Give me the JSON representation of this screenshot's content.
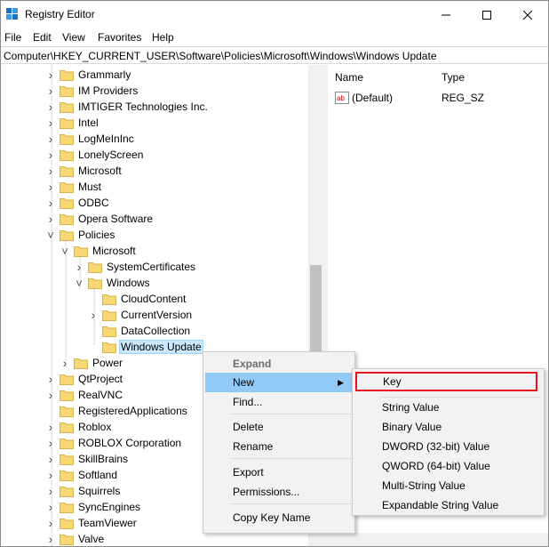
{
  "window": {
    "title": "Registry Editor"
  },
  "menubar": {
    "items": [
      "File",
      "Edit",
      "View",
      "Favorites",
      "Help"
    ]
  },
  "address": {
    "path": "Computer\\HKEY_CURRENT_USER\\Software\\Policies\\Microsoft\\Windows\\Windows Update"
  },
  "tree": {
    "items": [
      {
        "label": "Grammarly",
        "expander": "right",
        "level": 0
      },
      {
        "label": "IM Providers",
        "expander": "right",
        "level": 0
      },
      {
        "label": "IMTIGER Technologies Inc.",
        "expander": "right",
        "level": 0
      },
      {
        "label": "Intel",
        "expander": "right",
        "level": 0
      },
      {
        "label": "LogMeInInc",
        "expander": "right",
        "level": 0
      },
      {
        "label": "LonelyScreen",
        "expander": "right",
        "level": 0
      },
      {
        "label": "Microsoft",
        "expander": "right",
        "level": 0
      },
      {
        "label": "Must",
        "expander": "right",
        "level": 0
      },
      {
        "label": "ODBC",
        "expander": "right",
        "level": 0
      },
      {
        "label": "Opera Software",
        "expander": "right",
        "level": 0
      },
      {
        "label": "Policies",
        "expander": "down",
        "level": 0
      },
      {
        "label": "Microsoft",
        "expander": "down",
        "level": 1
      },
      {
        "label": "SystemCertificates",
        "expander": "right",
        "level": 2
      },
      {
        "label": "Windows",
        "expander": "down",
        "level": 2
      },
      {
        "label": "CloudContent",
        "expander": "none",
        "level": 3
      },
      {
        "label": "CurrentVersion",
        "expander": "right",
        "level": 3
      },
      {
        "label": "DataCollection",
        "expander": "none",
        "level": 3
      },
      {
        "label": "Windows Update",
        "expander": "none",
        "level": 3,
        "selected": true
      },
      {
        "label": "Power",
        "expander": "right",
        "level": 1
      },
      {
        "label": "QtProject",
        "expander": "right",
        "level": 0
      },
      {
        "label": "RealVNC",
        "expander": "right",
        "level": 0
      },
      {
        "label": "RegisteredApplications",
        "expander": "none",
        "level": 0
      },
      {
        "label": "Roblox",
        "expander": "right",
        "level": 0
      },
      {
        "label": "ROBLOX Corporation",
        "expander": "right",
        "level": 0
      },
      {
        "label": "SkillBrains",
        "expander": "right",
        "level": 0
      },
      {
        "label": "Softland",
        "expander": "right",
        "level": 0
      },
      {
        "label": "Squirrels",
        "expander": "right",
        "level": 0
      },
      {
        "label": "SyncEngines",
        "expander": "right",
        "level": 0
      },
      {
        "label": "TeamViewer",
        "expander": "right",
        "level": 0
      },
      {
        "label": "Valve",
        "expander": "right",
        "level": 0
      }
    ]
  },
  "list": {
    "columns": {
      "name": "Name",
      "type": "Type"
    },
    "rows": [
      {
        "name": "(Default)",
        "type": "REG_SZ",
        "icon": "string-value-icon"
      }
    ]
  },
  "context_menu": {
    "items": [
      {
        "label": "Expand",
        "style": "disabled"
      },
      {
        "label": "New",
        "style": "highlight",
        "submenu": true
      },
      {
        "label": "Find...",
        "style": "normal"
      },
      {
        "label": "Delete",
        "style": "normal"
      },
      {
        "label": "Rename",
        "style": "normal"
      },
      {
        "label": "Export",
        "style": "normal"
      },
      {
        "label": "Permissions...",
        "style": "normal"
      },
      {
        "label": "Copy Key Name",
        "style": "normal"
      }
    ]
  },
  "new_submenu": {
    "items": [
      {
        "label": "Key",
        "outlined": true
      },
      {
        "label": "String Value"
      },
      {
        "label": "Binary Value"
      },
      {
        "label": "DWORD (32-bit) Value"
      },
      {
        "label": "QWORD (64-bit) Value"
      },
      {
        "label": "Multi-String Value"
      },
      {
        "label": "Expandable String Value"
      }
    ]
  },
  "colors": {
    "highlight": "#91c9f7",
    "selected_bg": "#cce8ff",
    "annotation_outline": "#e81123",
    "folder": "#f8d775"
  }
}
